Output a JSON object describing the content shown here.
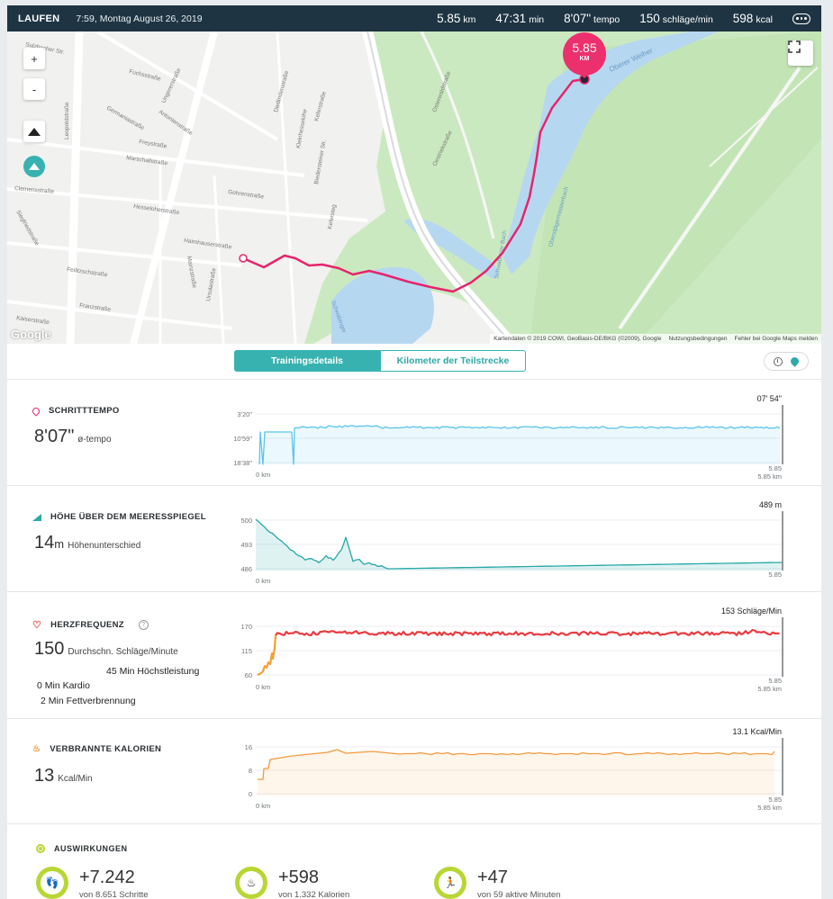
{
  "header": {
    "activity": "LAUFEN",
    "datetime": "7:59, Montag August 26, 2019",
    "stats": [
      {
        "value": "5.85",
        "unit": "km"
      },
      {
        "value": "47:31",
        "unit": "min"
      },
      {
        "value": "8'07\"",
        "unit": "tempo"
      },
      {
        "value": "150",
        "unit": "schläge/min"
      },
      {
        "value": "598",
        "unit": "kcal"
      }
    ],
    "more_icon": "ellipsis-icon"
  },
  "map": {
    "zoom_in": "+",
    "zoom_out": "-",
    "marker_value": "5.85",
    "marker_unit": "KM",
    "logo": "Google",
    "attribution": "Kartendaten © 2019 COWI, GeoBasis-DE/BKG (©2009), Google",
    "terms": "Nutzungsbedingungen",
    "report": "Fehler bei Google Maps melden",
    "streets": [
      "Sulzbacher Str.",
      "Fuchsstraße",
      "Ungererstraße",
      "Leopoldstraße",
      "Germaniastraße",
      "Antonienstraße",
      "Freystraße",
      "Marschallstraße",
      "Gohrenstraße",
      "Clemensstraße",
      "Hesseloherstraße",
      "Haimhauserstraße",
      "Feilitzschstraße",
      "Franzstraße",
      "Kaiserstraße",
      "Siegfriedstraße",
      "Mainzstraße",
      "Ursulastraße",
      "Biedersteiner Str.",
      "Kefersteg",
      "Oberer Weiher",
      "Schwabinger Bach",
      "Oberstjägermeisterbach",
      "Schwabinger",
      "Oestriekstraße",
      "Keferstraße",
      "Kleinhesselohe",
      "Dietlindenstraße",
      "Osterwaldstraße"
    ]
  },
  "tabs": {
    "details": "Trainingsdetails",
    "splits": "Kilometer der Teilstrecke"
  },
  "view_toggle": [
    "clock-icon",
    "location-pin-icon"
  ],
  "sections": {
    "pace": {
      "title": "SCHRITTTEMPO",
      "value": "8'07\"",
      "label": "ø-tempo",
      "peak": "07' 54\"",
      "y_ticks": [
        "3'20\"",
        "10'59\"",
        "18'38\""
      ],
      "x_start": "0 km",
      "x_end": "5.85",
      "x_end_sub": "5.85 km",
      "color": "#5bc4ec"
    },
    "elevation": {
      "title": "HÖHE ÜBER DEM MEERESSPIEGEL",
      "value": "14",
      "unit": "m",
      "label": "Höhenunterschied",
      "peak": "489 m",
      "y_ticks": [
        "500",
        "493",
        "486"
      ],
      "x_start": "0 km",
      "x_end": "5.85",
      "color": "#26a7a6"
    },
    "heart": {
      "title": "HERZFREQUENZ",
      "info": "?",
      "value": "150",
      "label": "Durchschn. Schläge/Minute",
      "zones": [
        "45 Min Höchstleistung",
        "0 Min Kardio",
        "2 Min Fettverbrennung"
      ],
      "peak": "153 Schläge/Min",
      "y_ticks": [
        "170",
        "115",
        "60"
      ],
      "x_start": "0 km",
      "x_end": "5.85",
      "x_end_sub": "5.85 km",
      "color": "#ea3a40"
    },
    "calories": {
      "title": "VERBRANNTE KALORIEN",
      "value": "13",
      "label": "Kcal/Min",
      "peak": "13.1 Kcal/Min",
      "y_ticks": [
        "16",
        "8",
        "0"
      ],
      "x_start": "0 km",
      "x_end": "5.85",
      "x_end_sub": "5.85 km",
      "color": "#f29a3f"
    }
  },
  "impact": {
    "title": "AUSWIRKUNGEN",
    "items": [
      {
        "value": "+7.242",
        "sub": "von 8.651 Schritte",
        "icon": "footsteps-icon"
      },
      {
        "value": "+598",
        "sub": "von 1.332 Kalorien",
        "icon": "flame-icon"
      },
      {
        "value": "+47",
        "sub": "von 59 aktive Minuten",
        "icon": "runner-icon"
      }
    ]
  },
  "chart_data": [
    {
      "type": "area",
      "title": "SCHRITTTEMPO",
      "x": [
        0,
        5.85
      ],
      "xlabel": "km",
      "ylim": [
        "18'38\"",
        "3'20\""
      ],
      "series": [
        {
          "values_min_per_km": [
            8.1,
            8.1
          ]
        }
      ]
    },
    {
      "type": "area",
      "title": "HÖHE ÜBER DEM MEERESSPIEGEL",
      "ylim": [
        486,
        500
      ],
      "series": [
        {
          "values": [
            500,
            497,
            493,
            490,
            489,
            490,
            495,
            487,
            486,
            486,
            489
          ]
        }
      ]
    },
    {
      "type": "line",
      "title": "HERZFREQUENZ",
      "ylim": [
        60,
        170
      ],
      "series": [
        {
          "values": [
            60,
            90,
            110,
            150,
            152,
            153,
            150,
            151,
            152,
            150,
            153,
            152
          ]
        }
      ]
    },
    {
      "type": "area",
      "title": "VERBRANNTE KALORIEN",
      "ylim": [
        0,
        16
      ],
      "series": [
        {
          "values": [
            4,
            9,
            12,
            12.5,
            13.5,
            12.8,
            13,
            13.2,
            13,
            13.1,
            13.5,
            13.1
          ]
        }
      ]
    }
  ]
}
